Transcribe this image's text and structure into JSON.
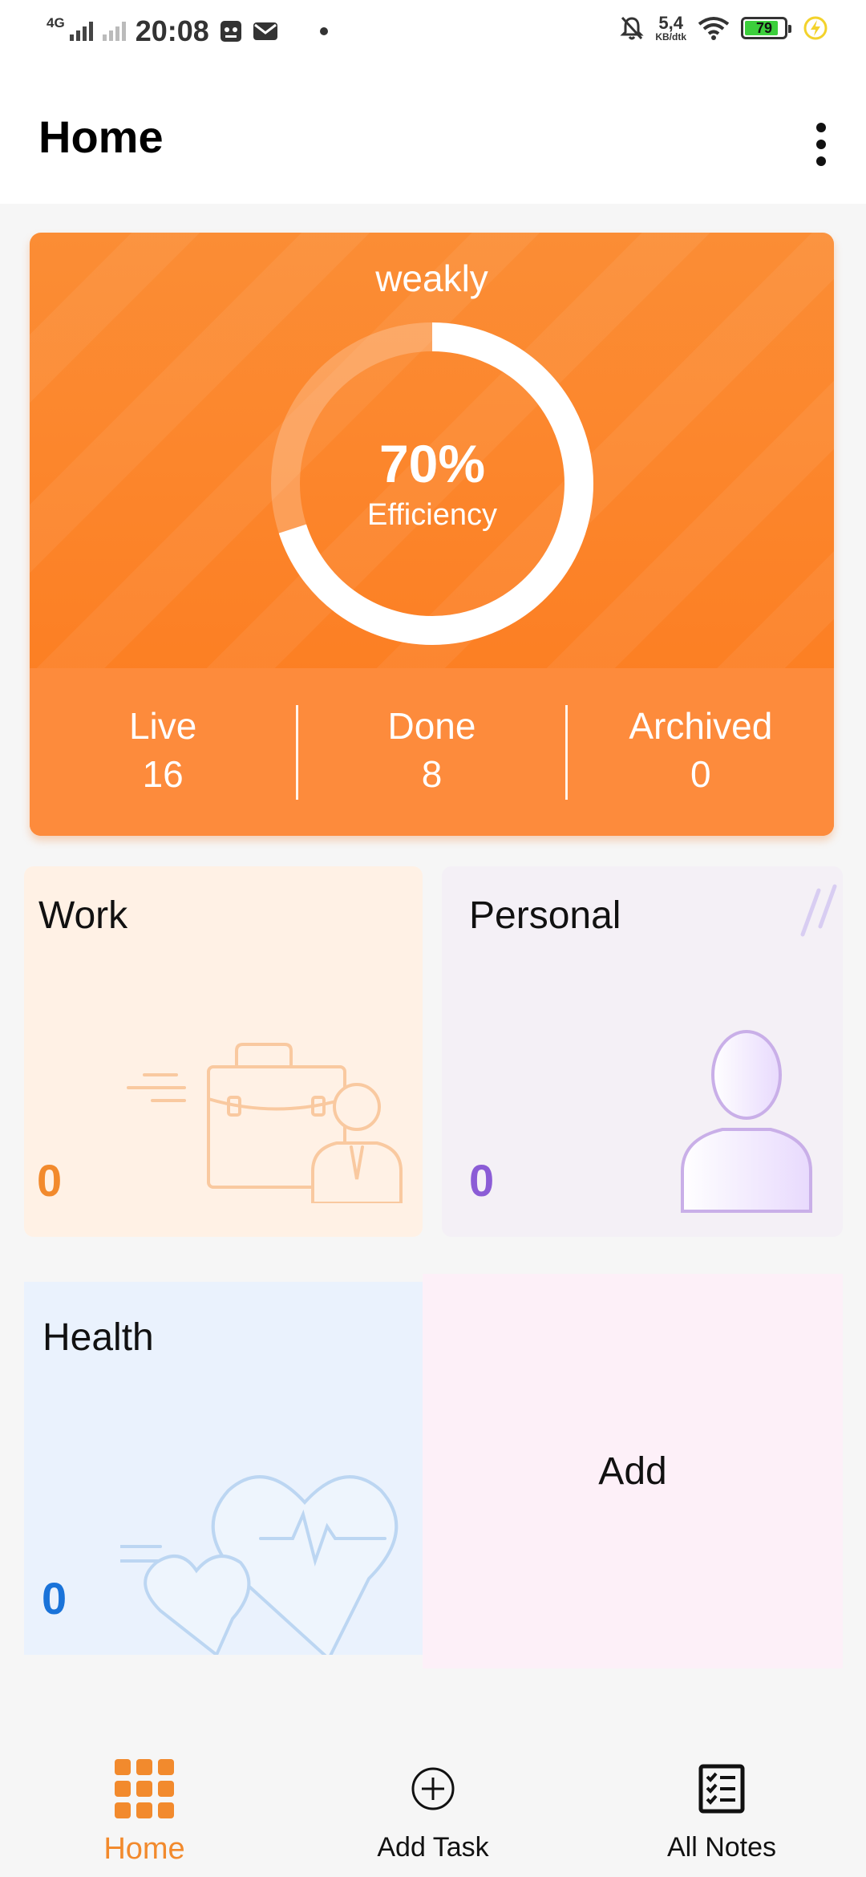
{
  "status_bar": {
    "network": "4G",
    "time": "20:08",
    "speed_value": "5,4",
    "speed_unit": "KB/dtk",
    "battery_level": "79",
    "icons": [
      "signal-icon",
      "camera-app-icon",
      "mail-icon",
      "dot-icon",
      "mute-icon",
      "wifi-icon",
      "battery-icon",
      "charging-icon"
    ]
  },
  "header": {
    "title": "Home",
    "menu_icon": "more-vertical-icon"
  },
  "summary": {
    "period": "weakly",
    "efficiency_value": "70%",
    "efficiency_fraction": 0.7,
    "efficiency_label": "Efficiency",
    "stats": [
      {
        "label": "Live",
        "value": "16"
      },
      {
        "label": "Done",
        "value": "8"
      },
      {
        "label": "Archived",
        "value": "0"
      }
    ],
    "accent_color": "#fd7a1d"
  },
  "categories": [
    {
      "title": "Work",
      "count": "0",
      "color": "#f28a2d",
      "icon": "briefcase-person-icon"
    },
    {
      "title": "Personal",
      "count": "0",
      "color": "#8b5cd6",
      "icon": "person-icon"
    },
    {
      "title": "Health",
      "count": "0",
      "color": "#1a73d9",
      "icon": "heart-pulse-icon"
    }
  ],
  "add_tile": {
    "label": "Add"
  },
  "bottom_nav": [
    {
      "label": "Home",
      "icon": "grid-icon",
      "active": true
    },
    {
      "label": "Add Task",
      "icon": "add-circle-icon",
      "active": false
    },
    {
      "label": "All Notes",
      "icon": "checklist-icon",
      "active": false
    }
  ]
}
